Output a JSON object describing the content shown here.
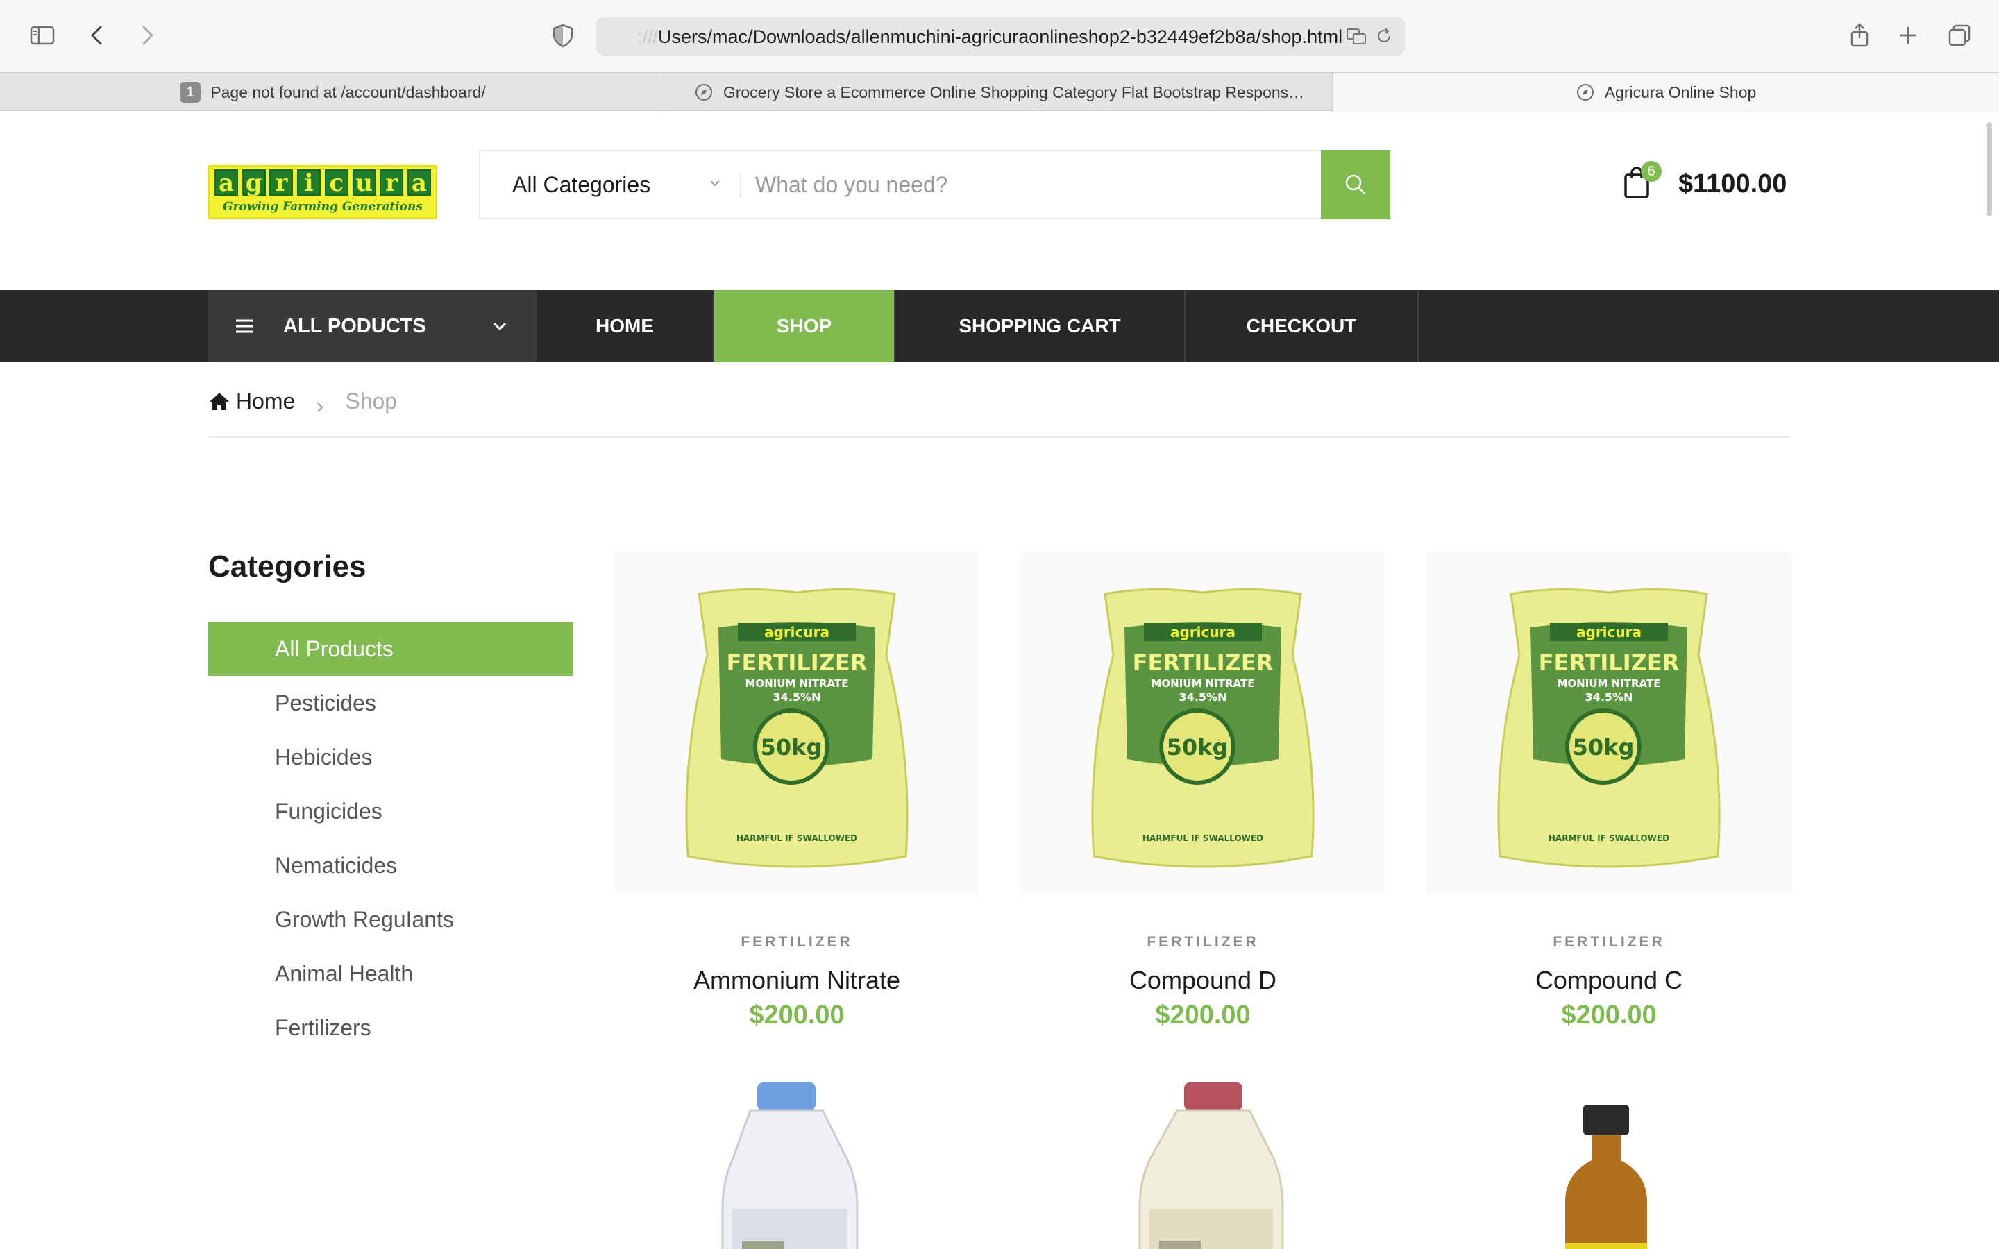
{
  "browser": {
    "url_prefix": ":///",
    "url": "Users/mac/Downloads/allenmuchini-agricuraonlineshop2-b32449ef2b8a/shop.html",
    "tabs": [
      {
        "badge": "1",
        "title": "Page not found at /account/dashboard/"
      },
      {
        "title": "Grocery Store a Ecommerce Online Shopping Category Flat Bootstrap Respons…"
      },
      {
        "title": "Agricura Online Shop"
      }
    ]
  },
  "header": {
    "logo_word": [
      "a",
      "g",
      "r",
      "i",
      "c",
      "u",
      "r",
      "a"
    ],
    "logo_tagline": "Growing Farming Generations",
    "category_select": "All Categories",
    "search_placeholder": "What do you need?",
    "cart_count": "6",
    "cart_total": "$1100.00"
  },
  "nav": {
    "all_products": "ALL PODUCTS",
    "items": [
      "HOME",
      "SHOP",
      "SHOPPING CART",
      "CHECKOUT"
    ],
    "active": "SHOP"
  },
  "breadcrumb": {
    "home": "Home",
    "current": "Shop"
  },
  "sidebar": {
    "title": "Categories",
    "items": [
      "All Products",
      "Pesticides",
      "Hebicides",
      "Fungicides",
      "Nematicides",
      "Growth ReguIants",
      "Animal Health",
      "Fertilizers"
    ],
    "active": "All Products"
  },
  "products": [
    {
      "category": "FERTILIZER",
      "name": "Ammonium Nitrate",
      "price": "$200.00"
    },
    {
      "category": "FERTILIZER",
      "name": "Compound D",
      "price": "$200.00"
    },
    {
      "category": "FERTILIZER",
      "name": "Compound C",
      "price": "$200.00"
    }
  ],
  "bag_label": {
    "brand": "agricura",
    "title": "FERTILIZER",
    "subtitle": "MONIUM NITRATE",
    "percent": "34.5%N",
    "weight": "50kg",
    "warning": "HARMFUL IF SWALLOWED"
  },
  "colors": {
    "accent": "#7fbb4f",
    "nav_bg": "#282828"
  }
}
